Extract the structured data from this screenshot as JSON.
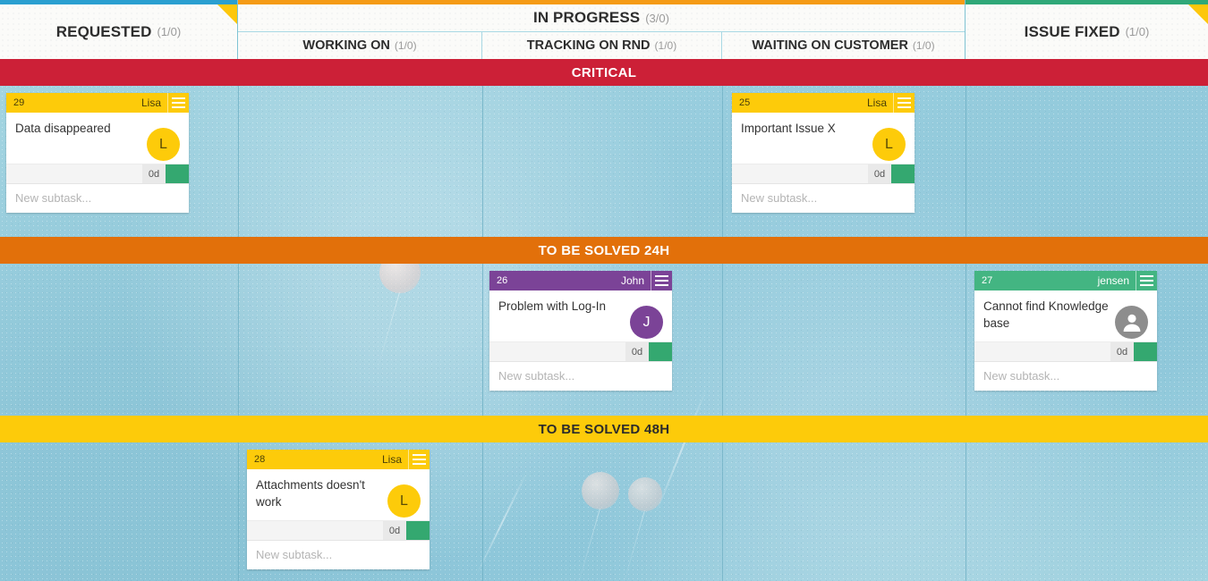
{
  "board": {
    "columns": [
      {
        "name": "REQUESTED",
        "count": "(1/0)",
        "accent": "#2a9fd0",
        "corner": true
      },
      {
        "name": "IN PROGRESS",
        "count": "(3/0)",
        "accent": "#f59b15",
        "corner": false,
        "subcolumns": [
          {
            "name": "WORKING ON",
            "count": "(1/0)"
          },
          {
            "name": "TRACKING ON RND",
            "count": "(1/0)"
          },
          {
            "name": "WAITING ON CUSTOMER",
            "count": "(1/0)"
          }
        ]
      },
      {
        "name": "ISSUE FIXED",
        "count": "(1/0)",
        "accent": "#2fa878",
        "corner": true
      }
    ],
    "swimlanes": [
      {
        "label": "CRITICAL",
        "color": "#cc2037",
        "text_color": "#ffffff"
      },
      {
        "label": "TO BE SOLVED 24H",
        "color": "#e2700a",
        "text_color": "#ffffff"
      },
      {
        "label": "TO BE SOLVED 48H",
        "color": "#fdcb0a",
        "text_color": "#2b2b2b"
      }
    ],
    "cards": [
      {
        "id": "29",
        "assignee": "Lisa",
        "title": "Data disappeared",
        "avatar_initial": "L",
        "avatar_type": "initial",
        "color": "y",
        "days": "0d",
        "subtask_placeholder": "New subtask...",
        "menu_icon": "hamburger-icon",
        "lane": "CRITICAL",
        "column": "REQUESTED"
      },
      {
        "id": "25",
        "assignee": "Lisa",
        "title": "Important Issue X",
        "avatar_initial": "L",
        "avatar_type": "initial",
        "color": "y",
        "days": "0d",
        "subtask_placeholder": "New subtask...",
        "menu_icon": "hamburger-icon",
        "lane": "CRITICAL",
        "column": "WAITING ON CUSTOMER"
      },
      {
        "id": "26",
        "assignee": "John",
        "title": "Problem with Log-In",
        "avatar_initial": "J",
        "avatar_type": "initial",
        "color": "p",
        "days": "0d",
        "subtask_placeholder": "New subtask...",
        "menu_icon": "hamburger-icon",
        "lane": "TO BE SOLVED 24H",
        "column": "TRACKING ON RND"
      },
      {
        "id": "27",
        "assignee": "jensen",
        "title": "Cannot find Knowledge base",
        "avatar_initial": "",
        "avatar_type": "silhouette",
        "color": "g",
        "days": "0d",
        "subtask_placeholder": "New subtask...",
        "menu_icon": "hamburger-icon",
        "lane": "TO BE SOLVED 24H",
        "column": "ISSUE FIXED"
      },
      {
        "id": "28",
        "assignee": "Lisa",
        "title": "Attachments doesn't work",
        "avatar_initial": "L",
        "avatar_type": "initial",
        "color": "y",
        "days": "0d",
        "subtask_placeholder": "New subtask...",
        "menu_icon": "hamburger-icon",
        "lane": "TO BE SOLVED 48H",
        "column": "WORKING ON"
      }
    ]
  }
}
